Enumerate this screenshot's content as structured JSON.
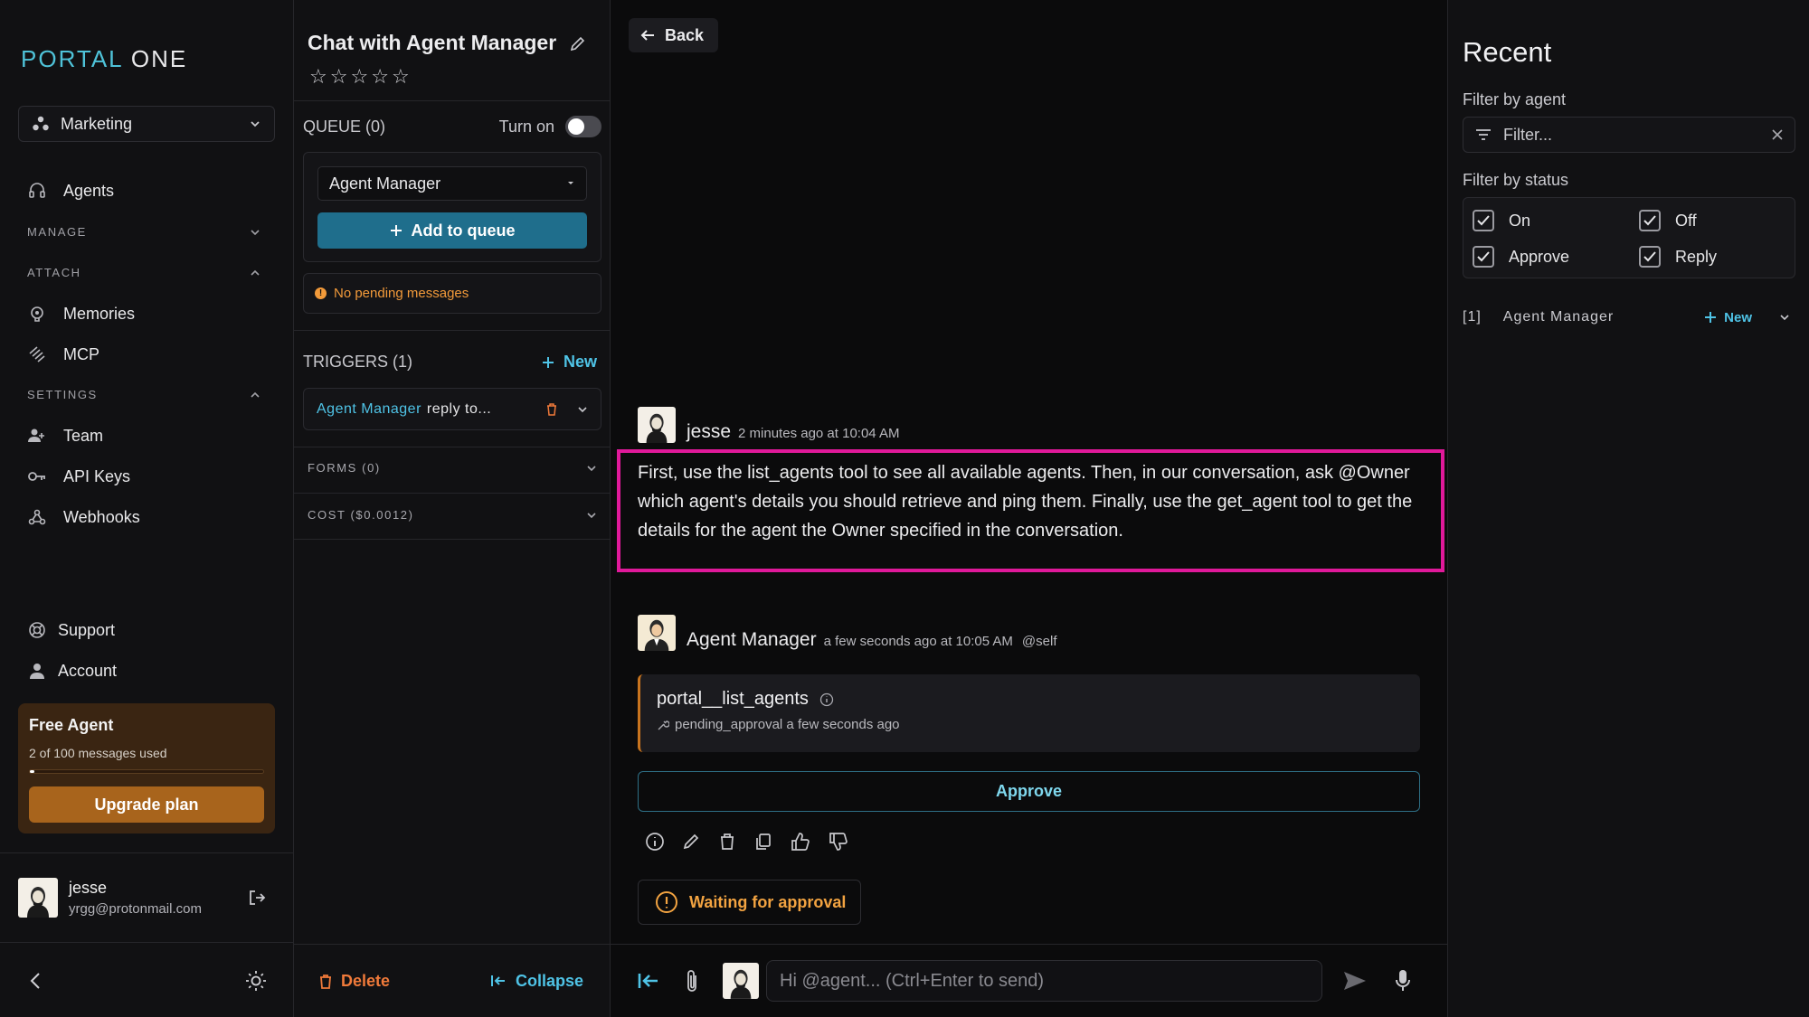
{
  "brand": {
    "logo_part1": "PORTAL",
    "logo_part2": " ONE"
  },
  "sidebar": {
    "workspace": "Marketing",
    "agents_label": "Agents",
    "sections": {
      "manage": "MANAGE",
      "attach": "ATTACH",
      "settings": "SETTINGS"
    },
    "attach_items": [
      "Memories",
      "MCP"
    ],
    "settings_items": [
      "Team",
      "API Keys",
      "Webhooks"
    ],
    "support": "Support",
    "account": "Account",
    "plan": {
      "title": "Free Agent",
      "usage_text": "2 of 100 messages used",
      "usage_fraction": 0.02,
      "upgrade_label": "Upgrade plan"
    },
    "user": {
      "name": "jesse",
      "email": "yrgg@protonmail.com"
    }
  },
  "chat_panel": {
    "title": "Chat with Agent Manager",
    "rating": 0,
    "queue_label": "QUEUE (0)",
    "turn_on_label": "Turn on",
    "agent_select": "Agent Manager",
    "add_to_queue_label": "Add to queue",
    "pending_text": "No pending messages",
    "triggers_label": "TRIGGERS (1)",
    "new_label": "New",
    "trigger_agent": "Agent Manager",
    "trigger_rest": "reply to...",
    "forms_label": "FORMS (0)",
    "cost_label": "COST ($0.0012)",
    "delete_label": "Delete",
    "collapse_label": "Collapse"
  },
  "main": {
    "back_label": "Back",
    "message1": {
      "author": "jesse",
      "time": "2 minutes ago at 10:04 AM",
      "text": "First, use the list_agents tool to see all available agents. Then, in our conversation, ask @Owner which agent's details you should retrieve and ping them. Finally, use the get_agent tool to get the details for the agent the Owner specified in the conversation."
    },
    "message2": {
      "author": "Agent Manager",
      "time": "a few seconds ago at 10:05 AM",
      "tag": "@self",
      "tool_name": "portal__list_agents",
      "tool_status": "pending_approval a few seconds ago",
      "approve_label": "Approve",
      "waiting_label": "Waiting for approval"
    },
    "composer_placeholder": "Hi @agent... (Ctrl+Enter to send)"
  },
  "recent": {
    "title": "Recent",
    "filter_agent_label": "Filter by agent",
    "filter_placeholder": "Filter...",
    "filter_status_label": "Filter by status",
    "statuses": {
      "on": "On",
      "off": "Off",
      "approve": "Approve",
      "reply": "Reply"
    },
    "list_index": "[1]",
    "list_agent": "Agent Manager",
    "list_new": "New"
  },
  "colors": {
    "accent": "#4fc3e6",
    "highlight": "#e0199a",
    "warning": "#f2a341",
    "danger": "#f07a3a"
  }
}
